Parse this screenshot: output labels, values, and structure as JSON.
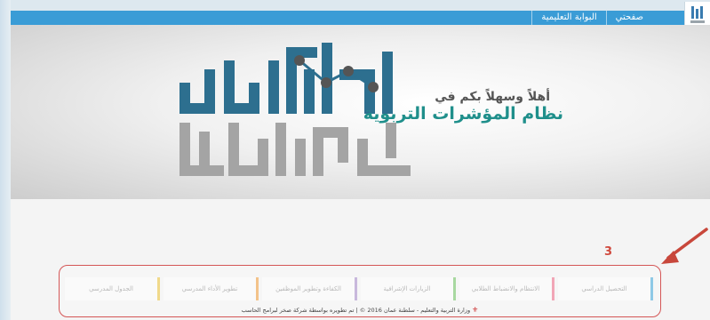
{
  "header": {
    "nav": [
      {
        "label": "صفحتي"
      },
      {
        "label": "البوابة التعليمية"
      }
    ]
  },
  "hero": {
    "welcome": "أهلاً وسهلاً بكم في",
    "system_name": "نظام المؤشرات التربوية"
  },
  "annotation": {
    "number": "3"
  },
  "tabs": [
    {
      "label": "التحصيل الدراسي",
      "color": "#8ec9e6"
    },
    {
      "label": "الانتظام والانضباط الطلابي",
      "color": "#f1a6b7"
    },
    {
      "label": "الزيارات الإشرافية",
      "color": "#a8d8a0"
    },
    {
      "label": "الكفاءة وتطوير الموظفين",
      "color": "#c8b8dc"
    },
    {
      "label": "تطوير الأداء المدرسي",
      "color": "#f3c38a"
    },
    {
      "label": "الجدول المدرسي",
      "color": "#f0d98a"
    }
  ],
  "footer": {
    "copyright": "وزارة التربية والتعليم - سلطنة عمان 2016 © | تم تطويره بواسطة شركة صخر لبرامج الحاسب"
  },
  "colors": {
    "topbar": "#3a9cd6",
    "accent_teal": "#1f8f8b",
    "annotation_red": "#d04a3e"
  }
}
